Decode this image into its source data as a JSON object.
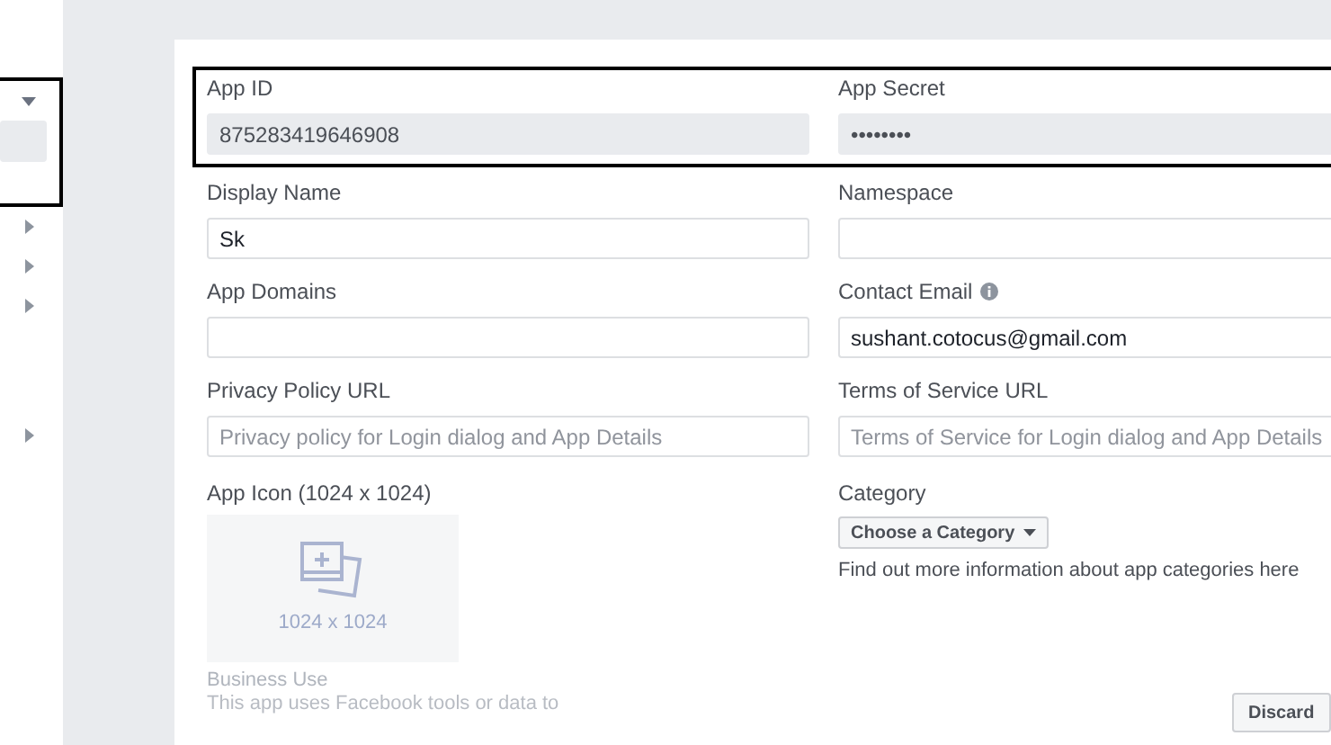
{
  "sidebar": {
    "items": [
      {
        "expanded": true,
        "children": [
          {
            "selected": true
          }
        ]
      },
      {
        "expanded": false
      },
      {
        "expanded": false
      },
      {
        "expanded": false
      },
      {
        "expanded": false
      }
    ]
  },
  "form": {
    "highlighted_row": {
      "highlighted": true,
      "fields": [
        {
          "label": "App ID",
          "value": "875283419646908",
          "disabled": true
        },
        {
          "label": "App Secret",
          "value": "••••••••",
          "disabled": true
        }
      ]
    },
    "rows": [
      [
        {
          "label": "Display Name",
          "value": "Sk",
          "disabled": false
        },
        {
          "label": "Namespace",
          "disabled": false
        }
      ],
      [
        {
          "label": "App Domains",
          "disabled": false
        },
        {
          "label": "Contact Email",
          "value": "sushant.cotocus@gmail.com",
          "info": true,
          "disabled": false
        }
      ],
      [
        {
          "label": "Privacy Policy URL",
          "placeholder": "Privacy policy for Login dialog and App Details",
          "disabled": false
        },
        {
          "label": "Terms of Service URL",
          "placeholder": "Terms of Service for Login dialog and App Details",
          "disabled": false
        }
      ]
    ],
    "app_icon": {
      "label": "App Icon (1024 x 1024)",
      "size_text": "1024 x 1024"
    },
    "category": {
      "label": "Category",
      "button": "Choose a Category",
      "help": "Find out more information about app categories here"
    },
    "business_use": {
      "title": "Business Use",
      "text": "This app uses Facebook tools or data to"
    }
  },
  "footer": {
    "buttons": [
      "Discard"
    ]
  }
}
